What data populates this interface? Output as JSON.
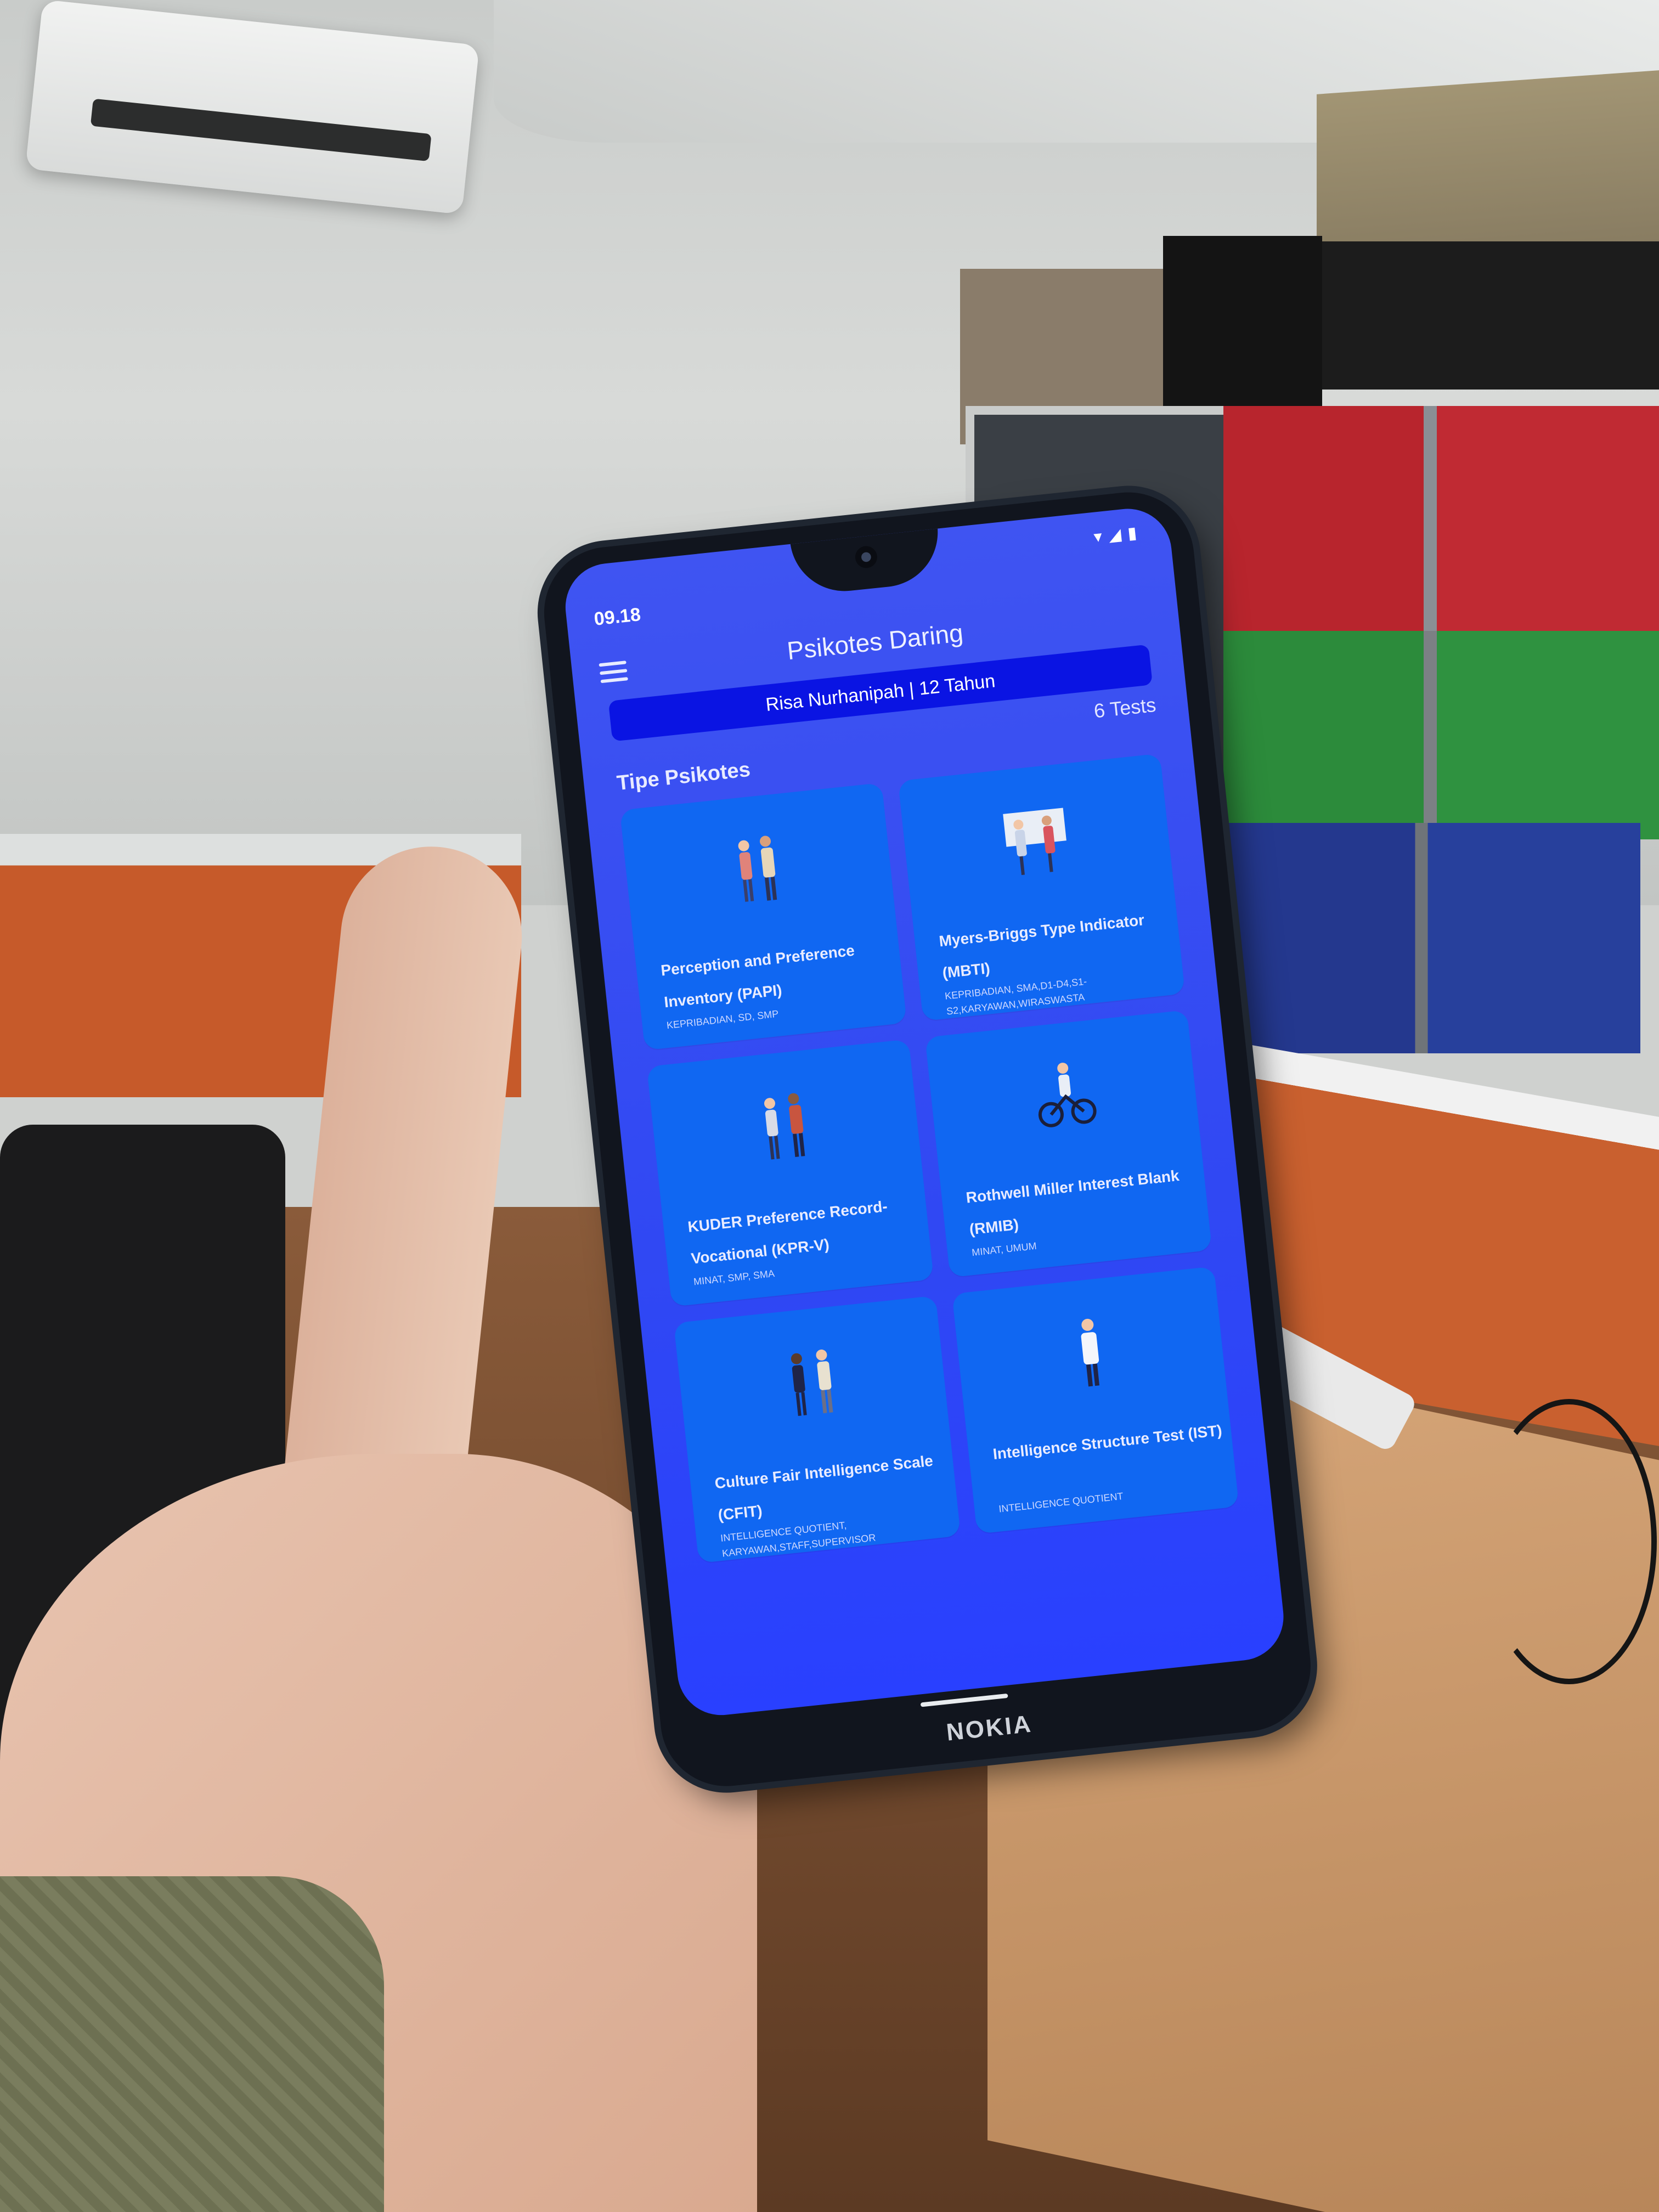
{
  "status_bar": {
    "time": "09.18"
  },
  "app": {
    "title": "Psikotes Daring",
    "user_banner": "Risa Nurhanipah | 12 Tahun",
    "tests_count": "6 Tests",
    "section_title": "Tipe Psikotes"
  },
  "tests": [
    {
      "title": "Perception and Preference Inventory (PAPI)",
      "meta": "KEPRIBADIAN, SD, SMP"
    },
    {
      "title": "Myers-Briggs Type Indicator (MBTI)",
      "meta": "KEPRIBADIAN, SMA,D1-D4,S1-S2,KARYAWAN,WIRASWASTA"
    },
    {
      "title": "KUDER Preference Record-Vocational (KPR-V)",
      "meta": "MINAT, SMP, SMA"
    },
    {
      "title": "Rothwell Miller Interest Blank (RMIB)",
      "meta": "MINAT, UMUM"
    },
    {
      "title": "Culture Fair Intelligence Scale (CFIT)",
      "meta": "INTELLIGENCE QUOTIENT, KARYAWAN,STAFF,SUPERVISOR"
    },
    {
      "title": "Intelligence Structure Test (IST)",
      "meta": "INTELLIGENCE QUOTIENT"
    }
  ],
  "device": {
    "brand": "NOKIA"
  },
  "colors": {
    "screen_bg": "#3048f3",
    "card_bg": "#1067f2",
    "banner_bg": "#0a14e3"
  }
}
